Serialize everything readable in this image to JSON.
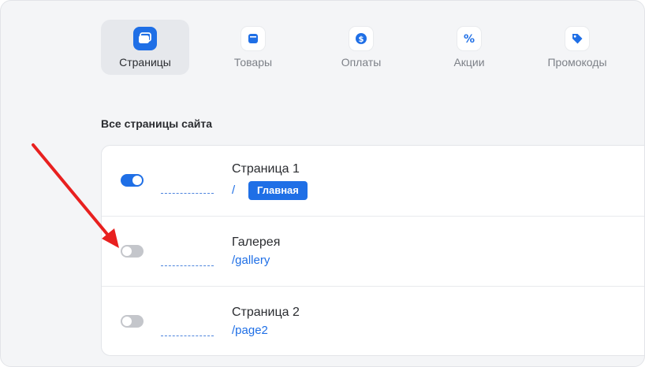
{
  "nav": {
    "items": [
      {
        "label": "Страницы",
        "icon": "pages-icon",
        "active": true
      },
      {
        "label": "Товары",
        "icon": "box-icon",
        "active": false
      },
      {
        "label": "Оплаты",
        "icon": "dollar-icon",
        "active": false
      },
      {
        "label": "Акции",
        "icon": "percent-icon",
        "active": false
      },
      {
        "label": "Промокоды",
        "icon": "tag-icon",
        "active": false
      }
    ]
  },
  "section": {
    "title": "Все страницы сайта"
  },
  "pages": [
    {
      "title": "Страница 1",
      "path": "/",
      "badge": "Главная",
      "enabled": true
    },
    {
      "title": "Галерея",
      "path": "/gallery",
      "enabled": false
    },
    {
      "title": "Страница 2",
      "path": "/page2",
      "enabled": false
    }
  ],
  "colors": {
    "accent": "#1f6fe6",
    "annotation_arrow": "#e8201f",
    "toggle_off": "#c4c6cb"
  }
}
